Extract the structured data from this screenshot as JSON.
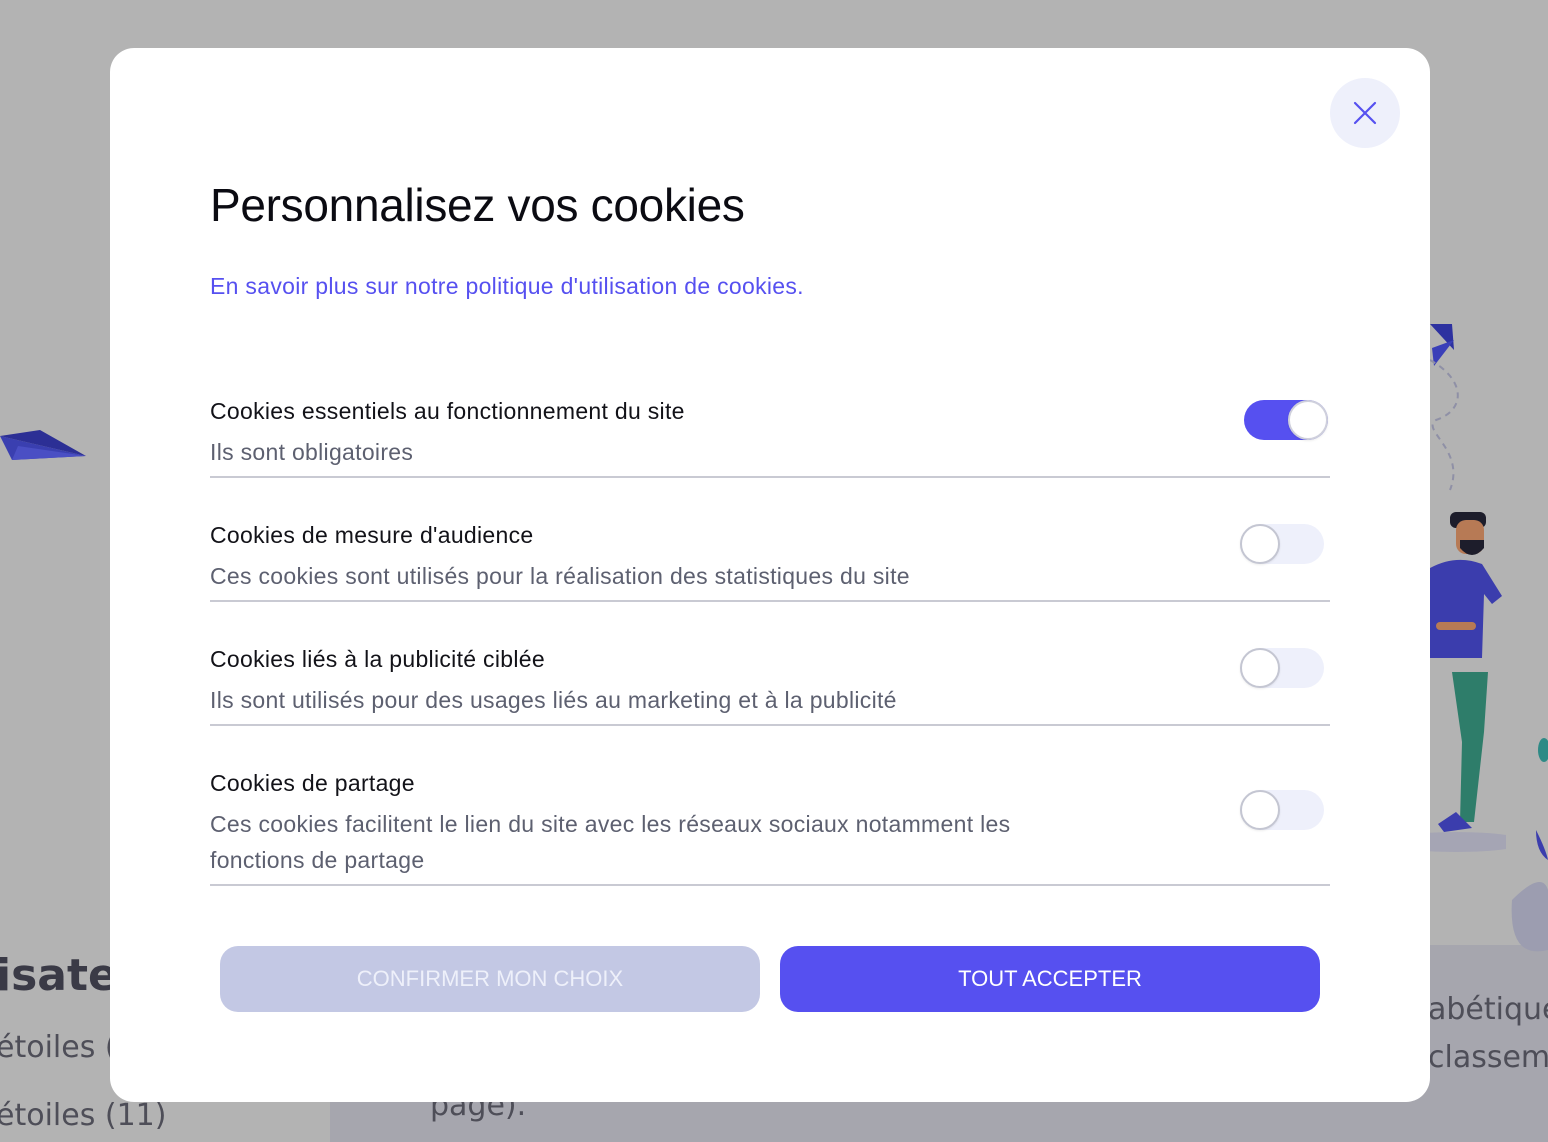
{
  "background": {
    "heading_fragment": "isateu",
    "line1": "étoiles (",
    "line2": "étoiles (11)",
    "right1": "abétique",
    "right2": "classeme",
    "bottom": "page)."
  },
  "modal": {
    "title": "Personnalisez vos cookies",
    "policy_link": "En savoir plus sur notre politique d'utilisation de cookies.",
    "close_icon": "close-icon",
    "cookies": [
      {
        "title": "Cookies essentiels au fonctionnement du site",
        "description": "Ils sont obligatoires",
        "enabled": true
      },
      {
        "title": "Cookies de mesure d'audience",
        "description": "Ces cookies sont utilisés pour la réalisation des statistiques du site",
        "enabled": false
      },
      {
        "title": "Cookies liés à la publicité ciblée",
        "description": "Ils sont utilisés pour des usages liés au marketing et à la publicité",
        "enabled": false
      },
      {
        "title": "Cookies de partage",
        "description": "Ces cookies facilitent le lien du site avec les réseaux sociaux notamment les fonctions de partage",
        "enabled": false
      }
    ],
    "confirm_label": "CONFIRMER MON CHOIX",
    "accept_label": "TOUT ACCEPTER"
  },
  "colors": {
    "accent": "#5650f0",
    "overlay": "#b3b3b3",
    "toggle_off": "#eef0fb",
    "confirm_button": "#c3c8e4"
  }
}
